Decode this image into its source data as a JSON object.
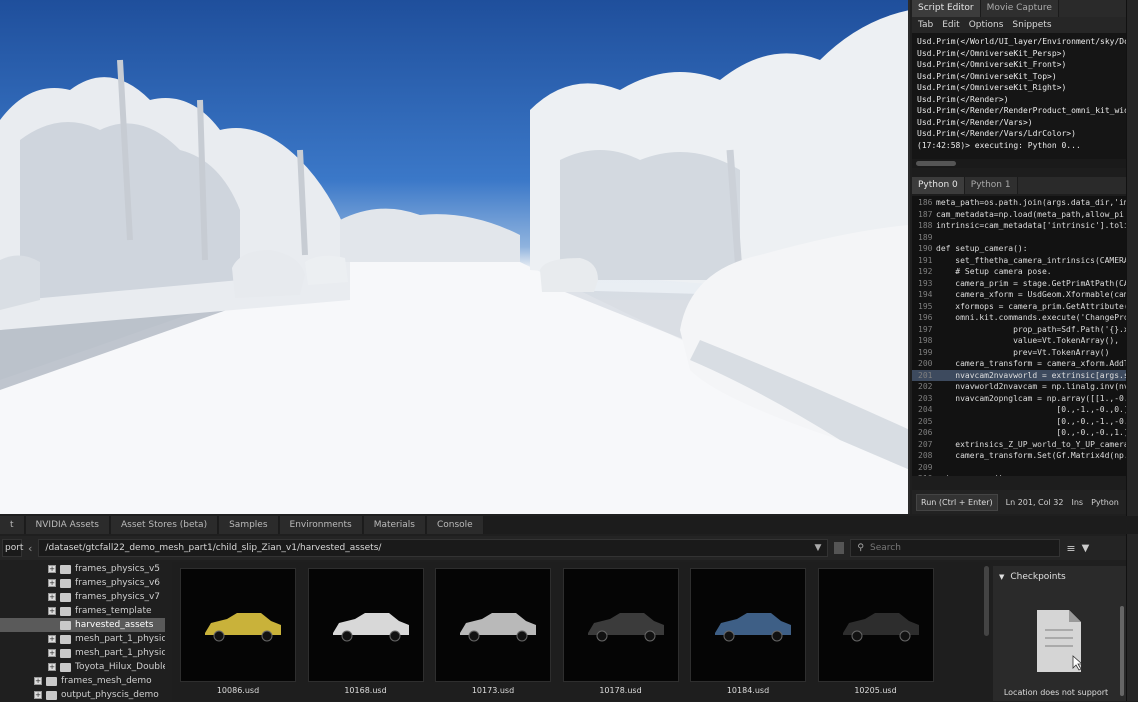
{
  "editor_tabs": [
    "Script Editor",
    "Movie Capture"
  ],
  "editor_menu": [
    "Tab",
    "Edit",
    "Options",
    "Snippets"
  ],
  "output_lines": [
    "Usd.Prim(</World/UI_layer/Environment/sky/Dome",
    "Usd.Prim(</OmniverseKit_Persp>)",
    "Usd.Prim(</OmniverseKit_Front>)",
    "Usd.Prim(</OmniverseKit_Top>)",
    "Usd.Prim(</OmniverseKit_Right>)",
    "Usd.Prim(</Render>)",
    "Usd.Prim(</Render/RenderProduct_omni_kit_widg",
    "Usd.Prim(</Render/Vars>)",
    "Usd.Prim(</Render/Vars/LdrColor>)",
    "(17:42:58)> executing: Python 0..."
  ],
  "python_tabs": [
    "Python 0",
    "Python 1"
  ],
  "code_lines": [
    {
      "n": "186",
      "t": "meta_path=os.path.join(args.data_dir,'imag"
    },
    {
      "n": "187",
      "t": "cam_metadata=np.load(meta_path,allow_pi"
    },
    {
      "n": "188",
      "t": "intrinsic=cam_metadata['intrinsic'].tolist()"
    },
    {
      "n": "189",
      "t": ""
    },
    {
      "n": "190",
      "t": "def setup_camera():"
    },
    {
      "n": "191",
      "t": "    set_fthetha_camera_intrinsics(CAMERA_PRIM"
    },
    {
      "n": "192",
      "t": "    # Setup camera pose."
    },
    {
      "n": "193",
      "t": "    camera_prim = stage.GetPrimAtPath(CAME"
    },
    {
      "n": "194",
      "t": "    camera_xform = UsdGeom.Xformable(cam"
    },
    {
      "n": "195",
      "t": "    xformops = camera_prim.GetAttribute(\"xfo"
    },
    {
      "n": "196",
      "t": "    omni.kit.commands.execute('ChangePrope"
    },
    {
      "n": "197",
      "t": "                prop_path=Sdf.Path('{}.xfor"
    },
    {
      "n": "198",
      "t": "                value=Vt.TokenArray(),"
    },
    {
      "n": "199",
      "t": "                prev=Vt.TokenArray()"
    },
    {
      "n": "200",
      "t": "    camera_transform = camera_xform.AddTra"
    },
    {
      "n": "201",
      "t": "    nvavcam2nvavworld = extrinsic[args.start"
    },
    {
      "n": "202",
      "t": "    nvavworld2nvavcam = np.linalg.inv(nvavca"
    },
    {
      "n": "203",
      "t": "    nvavcam2opnglcam = np.array([[1.,-0.,-0"
    },
    {
      "n": "204",
      "t": "                         [0.,-1.,-0.,0.],"
    },
    {
      "n": "205",
      "t": "                         [0.,-0.,-1.,-0.],"
    },
    {
      "n": "206",
      "t": "                         [0.,-0.,-0.,1.]])"
    },
    {
      "n": "207",
      "t": "    extrinsics_Z_UP_world_to_Y_UP_camera = n"
    },
    {
      "n": "208",
      "t": "    camera_transform.Set(Gf.Matrix4d(np.linal"
    },
    {
      "n": "209",
      "t": ""
    },
    {
      "n": "210",
      "t": "setup_camera()"
    },
    {
      "n": "211",
      "t": ""
    }
  ],
  "run_bar": {
    "run_label": "Run (Ctrl + Enter)",
    "cursor": "Ln 201, Col 32",
    "mode": "Ins",
    "language": "Python"
  },
  "bottom_tabs": [
    "t",
    "NVIDIA Assets",
    "Asset Stores (beta)",
    "Samples",
    "Environments",
    "Materials",
    "Console"
  ],
  "path_bar": {
    "left_label": "port",
    "path": "/dataset/gtcfall22_demo_mesh_part1/child_slip_Zian_v1/harvested_assets/",
    "search_placeholder": "Search"
  },
  "tree_items": [
    {
      "label": "frames_physics_v5",
      "indent": 1
    },
    {
      "label": "frames_physics_v6",
      "indent": 1
    },
    {
      "label": "frames_physics_v7",
      "indent": 1
    },
    {
      "label": "frames_template",
      "indent": 1
    },
    {
      "label": "harvested_assets",
      "indent": 1,
      "selected": true
    },
    {
      "label": "mesh_part_1_physics",
      "indent": 1
    },
    {
      "label": "mesh_part_1_physics_",
      "indent": 1
    },
    {
      "label": "Toyota_Hilux_Double",
      "indent": 1
    },
    {
      "label": "frames_mesh_demo",
      "indent": 0
    },
    {
      "label": "output_physcis_demo",
      "indent": 0
    }
  ],
  "assets": [
    {
      "file": "10086.usd",
      "color": "#c9b23a"
    },
    {
      "file": "10168.usd",
      "color": "#d8d8d8"
    },
    {
      "file": "10173.usd",
      "color": "#b9b9b9"
    },
    {
      "file": "10178.usd",
      "color": "#3b3b3b"
    },
    {
      "file": "10184.usd",
      "color": "#3e5f86"
    },
    {
      "file": "10205.usd",
      "color": "#2d2d2d"
    }
  ],
  "checkpoints": {
    "title": "Checkpoints",
    "message": "Location does not support"
  }
}
